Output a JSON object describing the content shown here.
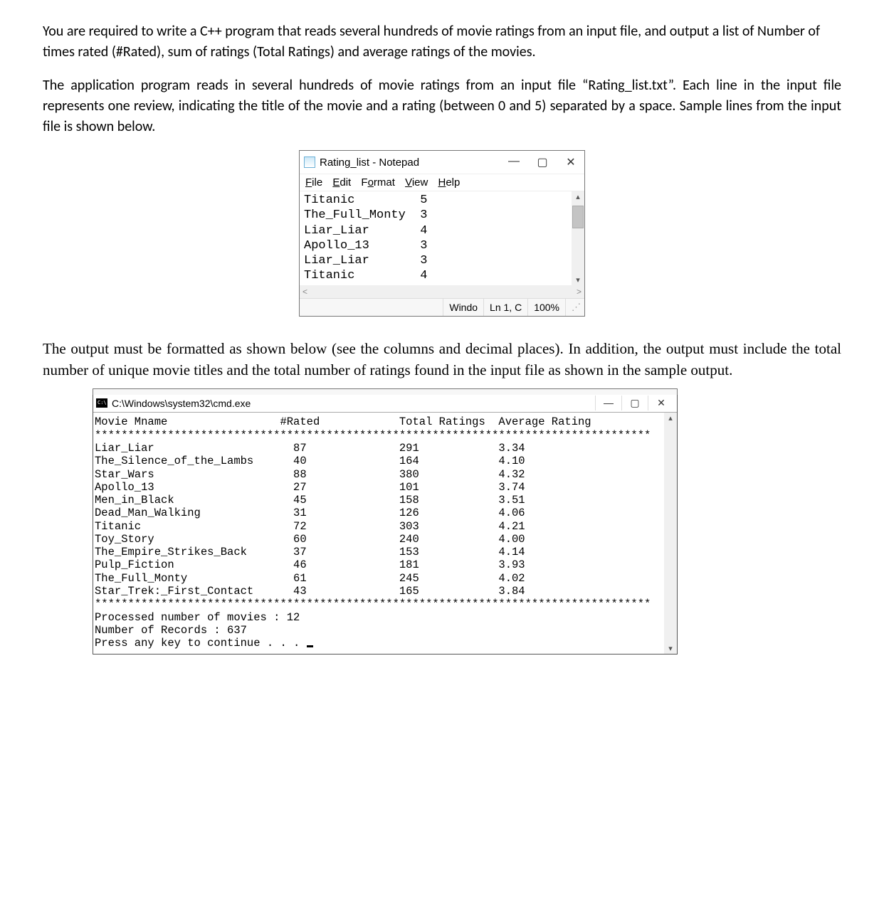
{
  "paragraphs": {
    "p1": "You are required to write a C++ program that reads several hundreds of movie ratings from an input file, and output a list of Number of times rated (#Rated), sum of ratings (Total Ratings) and average ratings of the movies.",
    "p2": "The application program reads in several hundreds of movie ratings from an input file “Rating_list.txt”.  Each line in the input file represents one review, indicating the title of the movie and a rating (between 0 and 5) separated by a space. Sample lines from the input file is shown below.",
    "p3": "The output must be formatted as shown below (see the columns and decimal places). In addition, the output must include the total number of unique movie titles and the total number of ratings found in the input file as shown in the sample output."
  },
  "notepad": {
    "title": "Rating_list - Notepad",
    "menu": {
      "file": "File",
      "edit": "Edit",
      "format": "Format",
      "view": "View",
      "help": "Help"
    },
    "lines": [
      {
        "title": "Titanic",
        "rating": "5"
      },
      {
        "title": "The_Full_Monty",
        "rating": "3"
      },
      {
        "title": "Liar_Liar",
        "rating": "4"
      },
      {
        "title": "Apollo_13",
        "rating": "3"
      },
      {
        "title": "Liar_Liar",
        "rating": "3"
      },
      {
        "title": "Titanic",
        "rating": "4"
      }
    ],
    "status": {
      "col1": "Windo",
      "col2": "Ln 1, C",
      "col3": "100%"
    }
  },
  "console": {
    "title": "C:\\Windows\\system32\\cmd.exe",
    "header": {
      "col1": "Movie Mname",
      "col2": "#Rated",
      "col3": "Total Ratings",
      "col4": "Average Rating"
    },
    "separator": "************************************************************************************",
    "rows": [
      {
        "name": "Liar_Liar",
        "rated": "87",
        "total": "291",
        "avg": "3.34"
      },
      {
        "name": "The_Silence_of_the_Lambs",
        "rated": "40",
        "total": "164",
        "avg": "4.10"
      },
      {
        "name": "Star_Wars",
        "rated": "88",
        "total": "380",
        "avg": "4.32"
      },
      {
        "name": "Apollo_13",
        "rated": "27",
        "total": "101",
        "avg": "3.74"
      },
      {
        "name": "Men_in_Black",
        "rated": "45",
        "total": "158",
        "avg": "3.51"
      },
      {
        "name": "Dead_Man_Walking",
        "rated": "31",
        "total": "126",
        "avg": "4.06"
      },
      {
        "name": "Titanic",
        "rated": "72",
        "total": "303",
        "avg": "4.21"
      },
      {
        "name": "Toy_Story",
        "rated": "60",
        "total": "240",
        "avg": "4.00"
      },
      {
        "name": "The_Empire_Strikes_Back",
        "rated": "37",
        "total": "153",
        "avg": "4.14"
      },
      {
        "name": "Pulp_Fiction",
        "rated": "46",
        "total": "181",
        "avg": "3.93"
      },
      {
        "name": "The_Full_Monty",
        "rated": "61",
        "total": "245",
        "avg": "4.02"
      },
      {
        "name": "Star_Trek:_First_Contact",
        "rated": "43",
        "total": "165",
        "avg": "3.84"
      }
    ],
    "footer": {
      "movies_label": "Processed number of movies : ",
      "movies_value": "12",
      "records_label": "Number of Records : ",
      "records_value": "637",
      "continue": "Press any key to continue . . . "
    }
  }
}
